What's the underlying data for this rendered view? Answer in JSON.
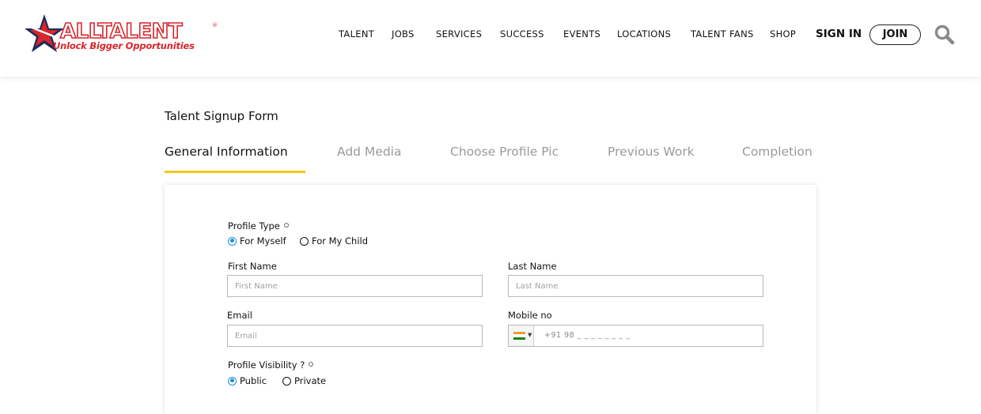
{
  "logo": {
    "wordmark": "ALLTALENT",
    "registered": "®",
    "tagline": "Unlock Bigger Opportunities",
    "colors": {
      "red": "#d7262d",
      "navy": "#1f2a5c"
    }
  },
  "nav": {
    "items": [
      "TALENT",
      "JOBS",
      "SERVICES",
      "SUCCESS",
      "EVENTS",
      "LOCATIONS",
      "TALENT FANS",
      "SHOP"
    ],
    "sign_in": "SIGN IN",
    "join": "JOIN"
  },
  "form": {
    "title": "Talent Signup Form",
    "tabs": [
      {
        "label": "General Information",
        "active": true
      },
      {
        "label": "Add Media",
        "active": false
      },
      {
        "label": "Choose Profile Pic",
        "active": false
      },
      {
        "label": "Previous Work",
        "active": false
      },
      {
        "label": "Completion",
        "active": false
      }
    ],
    "accent_color": "#f2c70f",
    "profile_type": {
      "label": "Profile Type",
      "options": [
        "For Myself",
        "For My Child"
      ],
      "selected": "For Myself"
    },
    "first_name": {
      "label": "First Name",
      "placeholder": "First Name"
    },
    "last_name": {
      "label": "Last Name",
      "placeholder": "Last Name"
    },
    "email": {
      "label": "Email",
      "placeholder": "Email"
    },
    "mobile": {
      "label": "Mobile no",
      "placeholder": "+91 98 _ _ _  _ _ _ _ _",
      "country_flag": "india-flag-icon"
    },
    "visibility": {
      "label": "Profile Visibility ?",
      "options": [
        "Public",
        "Private"
      ],
      "selected": "Public"
    },
    "radio_color": "#1f8fd6"
  }
}
